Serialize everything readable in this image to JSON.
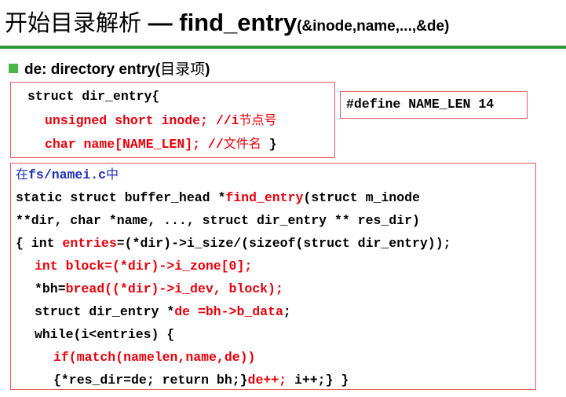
{
  "title": {
    "cn": "开始目录解析",
    "dash": " — ",
    "func": "find_entry",
    "args": "(&inode,name,...,&de)"
  },
  "bullet": {
    "en_prefix": "de:  directory entry(",
    "cn": "目录项",
    "en_suffix": ")"
  },
  "struct_box": {
    "line1": "struct dir_entry{",
    "line2_code": "unsigned short inode; //i",
    "line2_cn": "节点号",
    "line3_code": "char name[NAME_LEN]; //",
    "line3_cn": "文件名",
    "line3_end": " }"
  },
  "define_box": {
    "text": "#define NAME_LEN 14"
  },
  "code_box": {
    "file_cn": "在",
    "file_path": "fs/namei.c",
    "file_cn2": "中",
    "l1_a": "static struct buffer_head *",
    "l1_b": "find_entry",
    "l1_c": "(struct m_inode",
    "l2": "**dir, char *name, ..., struct dir_entry ** res_dir)",
    "l3_a": "{ int ",
    "l3_b": "entries",
    "l3_c": "=(*dir)->i_size/(sizeof(struct dir_entry));",
    "l4": "int block=(*dir)->i_zone[0];",
    "l5_a": "*bh=",
    "l5_b": "bread((*dir)->i_dev, block);",
    "l6_a": "struct dir_entry *",
    "l6_b": "de =bh->b_data",
    "l6_c": ";",
    "l7": "while(i<entries) {",
    "l8": "if(match(namelen,name,de))",
    "l9_a": "{*res_dir=de; return bh;}",
    "l9_b": "de++;",
    "l9_c": " i++;} }"
  },
  "colors": {
    "accent_red": "#e8000b",
    "box_border": "#e45b5b",
    "rule_green": "#2e9a3a",
    "bullet_green": "#4bb64a",
    "path_blue": "#1f2fb4"
  }
}
